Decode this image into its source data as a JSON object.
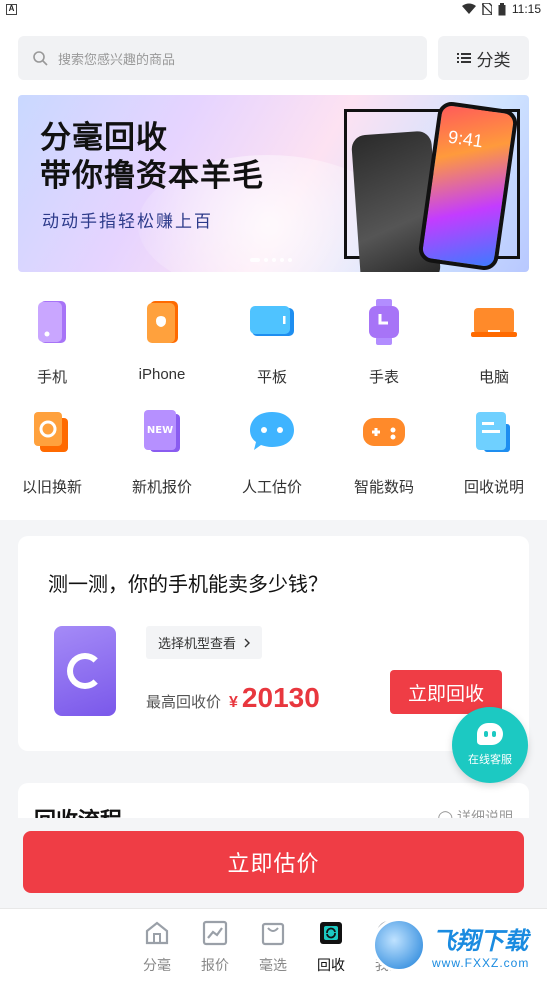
{
  "status_bar": {
    "time": "11:15",
    "sim_glyph": "A"
  },
  "search": {
    "placeholder": "搜索您感兴趣的商品",
    "category_label": "分类"
  },
  "banner": {
    "title_line1": "分毫回收",
    "title_line2": "带你撸资本羊毛",
    "subtitle": "动动手指轻松赚上百",
    "phone_time": "9:41"
  },
  "categories": [
    {
      "label": "手机",
      "icon": "phone-icon",
      "color": "#a774f7"
    },
    {
      "label": "iPhone",
      "icon": "apple-phone-icon",
      "color": "#ff7a1e"
    },
    {
      "label": "平板",
      "icon": "tablet-icon",
      "color": "#2ba7f5"
    },
    {
      "label": "手表",
      "icon": "watch-icon",
      "color": "#a774f7"
    },
    {
      "label": "电脑",
      "icon": "laptop-icon",
      "color": "#ff7a1e"
    },
    {
      "label": "以旧换新",
      "icon": "trade-in-icon",
      "color": "#ff7a1e"
    },
    {
      "label": "新机报价",
      "icon": "new-quote-icon",
      "color": "#a774f7"
    },
    {
      "label": "人工估价",
      "icon": "chat-icon",
      "color": "#2ba7f5"
    },
    {
      "label": "智能数码",
      "icon": "gamepad-icon",
      "color": "#ff7a1e"
    },
    {
      "label": "回收说明",
      "icon": "document-icon",
      "color": "#2ba7f5"
    }
  ],
  "quote_card": {
    "title": "测一测，你的手机能卖多少钱？",
    "select_model": "选择机型查看",
    "max_price_label": "最高回收价",
    "currency": "¥",
    "max_price": "20130",
    "recycle_button": "立即回收"
  },
  "support": {
    "label": "在线客服"
  },
  "process": {
    "title": "回收流程",
    "link": "详细说明"
  },
  "estimate_button": "立即估价",
  "tabs": [
    {
      "label": "分毫",
      "icon": "home-icon",
      "active": false
    },
    {
      "label": "报价",
      "icon": "chart-icon",
      "active": false
    },
    {
      "label": "毫选",
      "icon": "bag-icon",
      "active": false
    },
    {
      "label": "回收",
      "icon": "recycle-icon",
      "active": true
    },
    {
      "label": "我的",
      "icon": "user-icon",
      "active": false
    }
  ],
  "watermark": {
    "brand": "飞翔下载",
    "url": "www.FXXZ.com"
  },
  "colors": {
    "accent_red": "#ef3d45",
    "price_red": "#e8373e",
    "support_teal": "#1cc9c2"
  }
}
